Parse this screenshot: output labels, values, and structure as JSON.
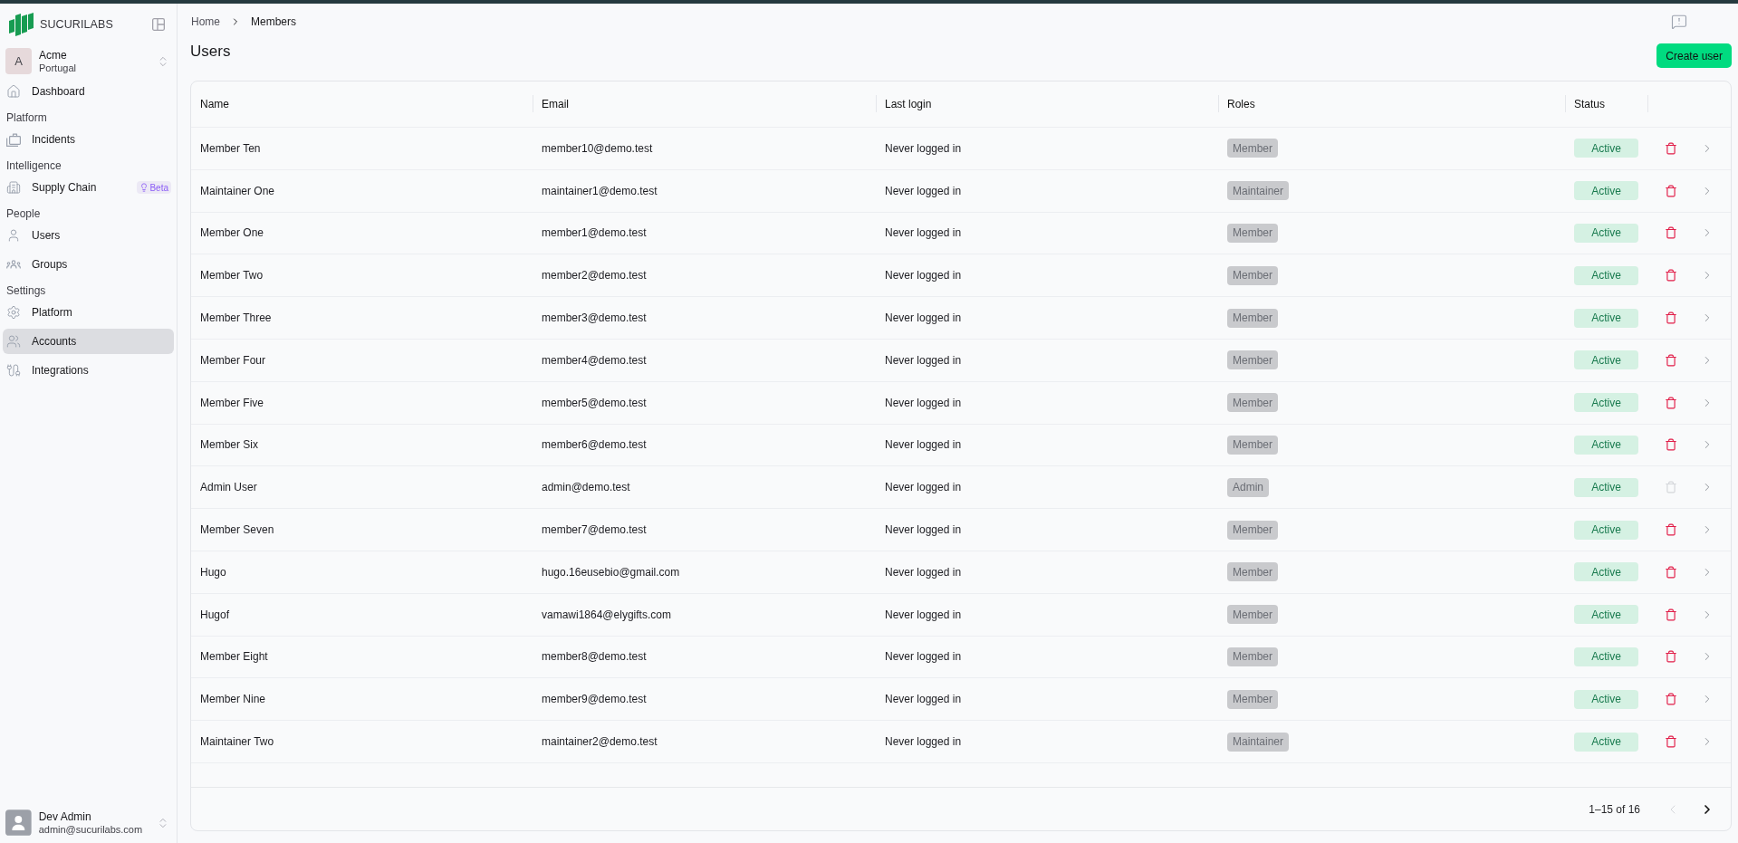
{
  "app": {
    "name": "SUCURILABS"
  },
  "org": {
    "initial": "A",
    "name": "Acme",
    "location": "Portugal"
  },
  "sidebar": {
    "groups": [
      {
        "items": [
          {
            "label": "Dashboard",
            "selected": false
          }
        ]
      },
      {
        "title": "Platform",
        "items": [
          {
            "label": "Incidents",
            "selected": false
          }
        ]
      },
      {
        "title": "Intelligence",
        "items": [
          {
            "label": "Supply Chain",
            "selected": false,
            "badge": "Beta"
          }
        ]
      },
      {
        "title": "People",
        "items": [
          {
            "label": "Users",
            "selected": false
          },
          {
            "label": "Groups",
            "selected": false
          }
        ]
      },
      {
        "title": "Settings",
        "items": [
          {
            "label": "Platform",
            "selected": false
          },
          {
            "label": "Accounts",
            "selected": true
          },
          {
            "label": "Integrations",
            "selected": false
          }
        ]
      }
    ]
  },
  "account": {
    "name": "Dev Admin",
    "email": "admin@sucurilabs.com"
  },
  "breadcrumb": [
    {
      "label": "Home",
      "current": false
    },
    {
      "label": "Members",
      "current": true
    }
  ],
  "page": {
    "title": "Users",
    "create_button": "Create user"
  },
  "table": {
    "columns": [
      "Name",
      "Email",
      "Last login",
      "Roles",
      "Status"
    ],
    "rows": [
      {
        "name": "Member Ten",
        "email": "member10@demo.test",
        "last_login": "Never logged in",
        "role": "Member",
        "status": "Active",
        "delete_disabled": false
      },
      {
        "name": "Maintainer One",
        "email": "maintainer1@demo.test",
        "last_login": "Never logged in",
        "role": "Maintainer",
        "status": "Active",
        "delete_disabled": false
      },
      {
        "name": "Member One",
        "email": "member1@demo.test",
        "last_login": "Never logged in",
        "role": "Member",
        "status": "Active",
        "delete_disabled": false
      },
      {
        "name": "Member Two",
        "email": "member2@demo.test",
        "last_login": "Never logged in",
        "role": "Member",
        "status": "Active",
        "delete_disabled": false
      },
      {
        "name": "Member Three",
        "email": "member3@demo.test",
        "last_login": "Never logged in",
        "role": "Member",
        "status": "Active",
        "delete_disabled": false
      },
      {
        "name": "Member Four",
        "email": "member4@demo.test",
        "last_login": "Never logged in",
        "role": "Member",
        "status": "Active",
        "delete_disabled": false
      },
      {
        "name": "Member Five",
        "email": "member5@demo.test",
        "last_login": "Never logged in",
        "role": "Member",
        "status": "Active",
        "delete_disabled": false
      },
      {
        "name": "Member Six",
        "email": "member6@demo.test",
        "last_login": "Never logged in",
        "role": "Member",
        "status": "Active",
        "delete_disabled": false
      },
      {
        "name": "Admin User",
        "email": "admin@demo.test",
        "last_login": "Never logged in",
        "role": "Admin",
        "status": "Active",
        "delete_disabled": true
      },
      {
        "name": "Member Seven",
        "email": "member7@demo.test",
        "last_login": "Never logged in",
        "role": "Member",
        "status": "Active",
        "delete_disabled": false
      },
      {
        "name": "Hugo",
        "email": "hugo.16eusebio@gmail.com",
        "last_login": "Never logged in",
        "role": "Member",
        "status": "Active",
        "delete_disabled": false
      },
      {
        "name": "Hugof",
        "email": "vamawi1864@elygifts.com",
        "last_login": "Never logged in",
        "role": "Member",
        "status": "Active",
        "delete_disabled": false
      },
      {
        "name": "Member Eight",
        "email": "member8@demo.test",
        "last_login": "Never logged in",
        "role": "Member",
        "status": "Active",
        "delete_disabled": false
      },
      {
        "name": "Member Nine",
        "email": "member9@demo.test",
        "last_login": "Never logged in",
        "role": "Member",
        "status": "Active",
        "delete_disabled": false
      },
      {
        "name": "Maintainer Two",
        "email": "maintainer2@demo.test",
        "last_login": "Never logged in",
        "role": "Maintainer",
        "status": "Active",
        "delete_disabled": false
      }
    ],
    "pagination": {
      "range": "1–15 of 16",
      "prev_disabled": true,
      "next_disabled": false
    }
  }
}
